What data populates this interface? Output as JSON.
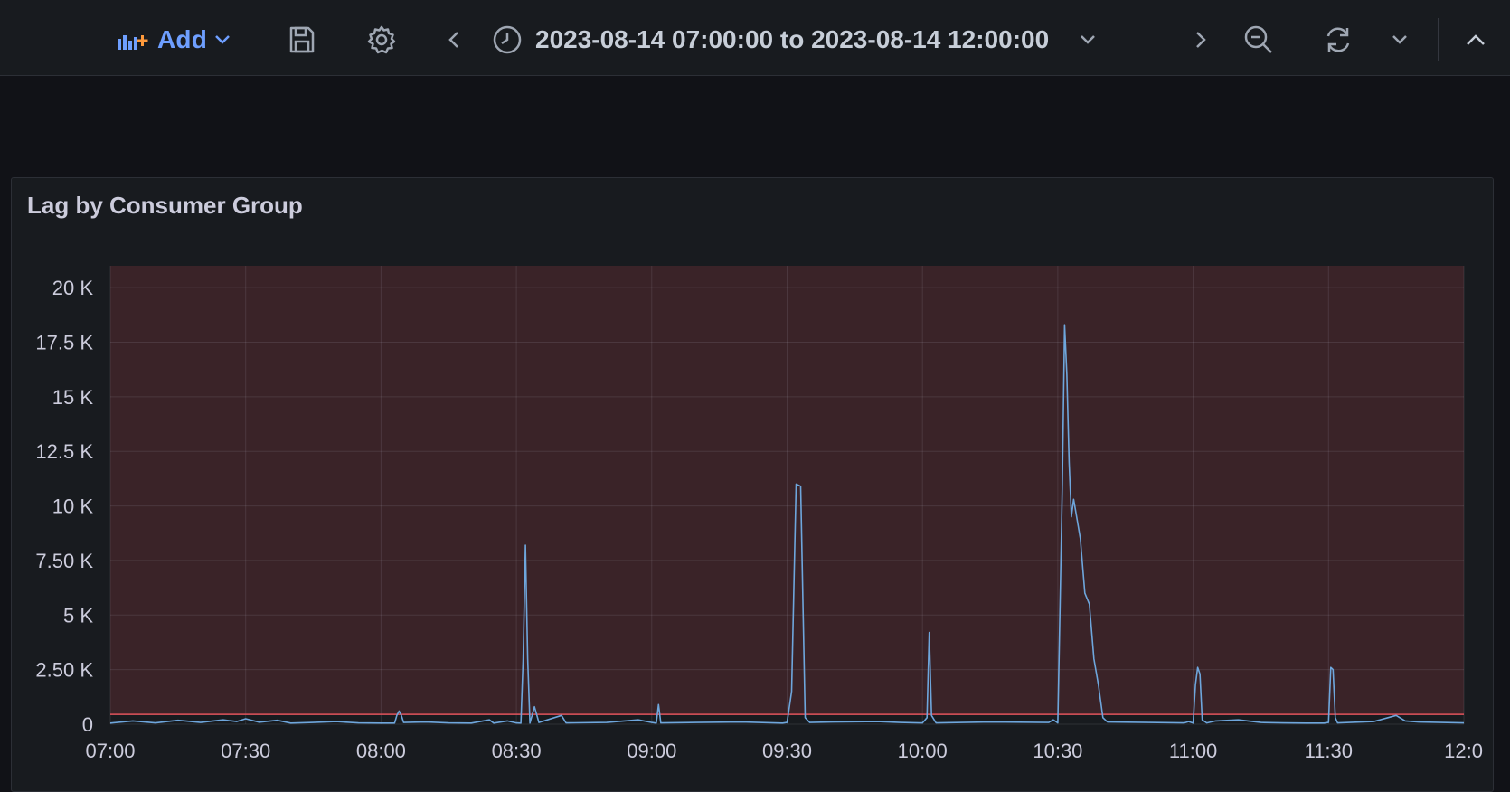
{
  "toolbar": {
    "add_label": "Add",
    "time_range": "2023-08-14 07:00:00 to 2023-08-14 12:00:00",
    "icons": [
      "add-panel-icon",
      "chevron-down-icon",
      "save-icon",
      "gear-icon",
      "chevron-left-icon",
      "clock-icon",
      "chevron-down-icon",
      "chevron-right-icon",
      "zoom-out-icon",
      "refresh-icon",
      "chevron-down-icon",
      "chevron-up-icon"
    ]
  },
  "panel": {
    "title": "Lag by Consumer Group"
  },
  "colors": {
    "line": "#6ea6dc",
    "threshold_line": "#e0535c",
    "threshold_fill": "#3a2328",
    "accent": "#6e9fff"
  },
  "chart_data": {
    "type": "line",
    "title": "Lag by Consumer Group",
    "xlabel": "",
    "ylabel": "",
    "x_ticks": [
      "07:00",
      "07:30",
      "08:00",
      "08:30",
      "09:00",
      "09:30",
      "10:00",
      "10:30",
      "11:00",
      "11:30",
      "12:0"
    ],
    "y_ticks": [
      {
        "value": 0,
        "label": "0"
      },
      {
        "value": 2500,
        "label": "2.50 K"
      },
      {
        "value": 5000,
        "label": "5 K"
      },
      {
        "value": 7500,
        "label": "7.50 K"
      },
      {
        "value": 10000,
        "label": "10 K"
      },
      {
        "value": 12500,
        "label": "12.5 K"
      },
      {
        "value": 15000,
        "label": "15 K"
      },
      {
        "value": 17500,
        "label": "17.5 K"
      },
      {
        "value": 20000,
        "label": "20 K"
      }
    ],
    "xlim": [
      "07:00",
      "12:00"
    ],
    "ylim": [
      0,
      21000
    ],
    "threshold": 450,
    "grid": true,
    "series": [
      {
        "name": "",
        "points": [
          [
            "07:00",
            50
          ],
          [
            "07:05",
            150
          ],
          [
            "07:10",
            60
          ],
          [
            "07:15",
            180
          ],
          [
            "07:20",
            80
          ],
          [
            "07:25",
            200
          ],
          [
            "07:28",
            120
          ],
          [
            "07:30",
            250
          ],
          [
            "07:33",
            90
          ],
          [
            "07:37",
            180
          ],
          [
            "07:40",
            50
          ],
          [
            "07:45",
            80
          ],
          [
            "07:50",
            120
          ],
          [
            "07:55",
            60
          ],
          [
            "08:00",
            50
          ],
          [
            "08:03",
            50
          ],
          [
            "08:03.5",
            400
          ],
          [
            "08:04",
            600
          ],
          [
            "08:04.5",
            400
          ],
          [
            "08:05",
            80
          ],
          [
            "08:10",
            100
          ],
          [
            "08:15",
            60
          ],
          [
            "08:20",
            50
          ],
          [
            "08:24",
            200
          ],
          [
            "08:25",
            50
          ],
          [
            "08:28",
            150
          ],
          [
            "08:30",
            60
          ],
          [
            "08:31",
            50
          ],
          [
            "08:31.5",
            3000
          ],
          [
            "08:32",
            8200
          ],
          [
            "08:32.5",
            3000
          ],
          [
            "08:33",
            50
          ],
          [
            "08:34",
            800
          ],
          [
            "08:35",
            80
          ],
          [
            "08:40",
            400
          ],
          [
            "08:41",
            60
          ],
          [
            "08:50",
            80
          ],
          [
            "08:57",
            200
          ],
          [
            "09:00",
            80
          ],
          [
            "09:01",
            50
          ],
          [
            "09:01.5",
            900
          ],
          [
            "09:02",
            60
          ],
          [
            "09:10",
            80
          ],
          [
            "09:20",
            100
          ],
          [
            "09:29",
            50
          ],
          [
            "09:30",
            80
          ],
          [
            "09:31",
            1500
          ],
          [
            "09:32",
            11000
          ],
          [
            "09:33",
            10900
          ],
          [
            "09:34",
            300
          ],
          [
            "09:35",
            80
          ],
          [
            "09:40",
            100
          ],
          [
            "09:50",
            120
          ],
          [
            "09:55",
            80
          ],
          [
            "10:00",
            60
          ],
          [
            "10:01",
            300
          ],
          [
            "10:01.5",
            4200
          ],
          [
            "10:02",
            400
          ],
          [
            "10:03",
            60
          ],
          [
            "10:15",
            100
          ],
          [
            "10:28",
            80
          ],
          [
            "10:29",
            200
          ],
          [
            "10:30",
            60
          ],
          [
            "10:31",
            11000
          ],
          [
            "10:31.5",
            18300
          ],
          [
            "10:32",
            16000
          ],
          [
            "10:32.5",
            12000
          ],
          [
            "10:33",
            9500
          ],
          [
            "10:33.5",
            10300
          ],
          [
            "10:34",
            9700
          ],
          [
            "10:35",
            8500
          ],
          [
            "10:36",
            6000
          ],
          [
            "10:37",
            5500
          ],
          [
            "10:38",
            3000
          ],
          [
            "10:39",
            1800
          ],
          [
            "10:40",
            300
          ],
          [
            "10:41",
            100
          ],
          [
            "10:50",
            80
          ],
          [
            "10:58",
            60
          ],
          [
            "10:59",
            120
          ],
          [
            "11:00",
            50
          ],
          [
            "11:00.5",
            1800
          ],
          [
            "11:01",
            2600
          ],
          [
            "11:01.5",
            2300
          ],
          [
            "11:02",
            200
          ],
          [
            "11:03",
            60
          ],
          [
            "11:05",
            150
          ],
          [
            "11:10",
            200
          ],
          [
            "11:15",
            80
          ],
          [
            "11:20",
            60
          ],
          [
            "11:25",
            50
          ],
          [
            "11:29",
            50
          ],
          [
            "11:30",
            80
          ],
          [
            "11:30.5",
            2600
          ],
          [
            "11:31",
            2500
          ],
          [
            "11:31.5",
            300
          ],
          [
            "11:32",
            60
          ],
          [
            "11:40",
            120
          ],
          [
            "11:45",
            400
          ],
          [
            "11:47",
            150
          ],
          [
            "11:50",
            100
          ],
          [
            "11:55",
            80
          ],
          [
            "12:00",
            60
          ]
        ]
      }
    ]
  }
}
